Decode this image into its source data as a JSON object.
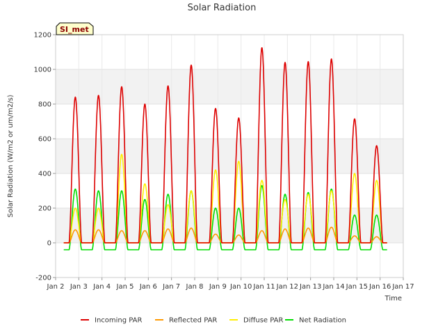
{
  "chart_data": {
    "type": "line",
    "title": "Solar Radiation",
    "xlabel": "Time",
    "ylabel": "Solar Radiation (W/m2 or um/m2/s)",
    "site_label": "SI_met",
    "xlim": [
      2,
      17
    ],
    "ylim": [
      -200,
      1200
    ],
    "x_ticks": [
      2,
      3,
      4,
      5,
      6,
      7,
      8,
      9,
      10,
      11,
      12,
      13,
      14,
      15,
      16,
      17
    ],
    "x_tick_labels": [
      "Jan 2",
      "Jan 3",
      "Jan 4",
      "Jan 5",
      "Jan 6",
      "Jan 7",
      "Jan 8",
      "Jan 9",
      "Jan 10",
      "Jan 11",
      "Jan 12",
      "Jan 13",
      "Jan 14",
      "Jan 15",
      "Jan 16",
      "Jan 17"
    ],
    "y_ticks": [
      -200,
      0,
      200,
      400,
      600,
      800,
      1000,
      1200
    ],
    "y_tick_labels": [
      "-200",
      "0",
      "200",
      "400",
      "600",
      "800",
      "1000",
      "1200"
    ],
    "grid": true,
    "legend_position": "bottom",
    "day_peak_x": [
      2.85,
      3.85,
      4.85,
      5.85,
      6.85,
      7.85,
      8.9,
      9.9,
      10.9,
      11.9,
      12.9,
      13.9,
      14.9,
      15.85
    ],
    "series": [
      {
        "name": "Incoming PAR",
        "color": "#dd0000",
        "baseline": 0,
        "peaks": [
          840,
          850,
          900,
          800,
          905,
          1025,
          775,
          720,
          1125,
          1040,
          1045,
          1060,
          715,
          560
        ]
      },
      {
        "name": "Reflected PAR",
        "color": "#ff9900",
        "baseline": 0,
        "peaks": [
          75,
          75,
          70,
          70,
          80,
          85,
          50,
          45,
          70,
          80,
          85,
          90,
          40,
          35
        ]
      },
      {
        "name": "Diffuse PAR",
        "color": "#ffee00",
        "baseline": 0,
        "peaks": [
          200,
          200,
          510,
          340,
          220,
          300,
          420,
          470,
          360,
          250,
          280,
          300,
          400,
          360
        ]
      },
      {
        "name": "Net Radiation",
        "color": "#00dd00",
        "baseline": -40,
        "peaks": [
          310,
          300,
          300,
          250,
          280,
          300,
          200,
          200,
          330,
          280,
          290,
          310,
          160,
          160
        ]
      }
    ]
  }
}
